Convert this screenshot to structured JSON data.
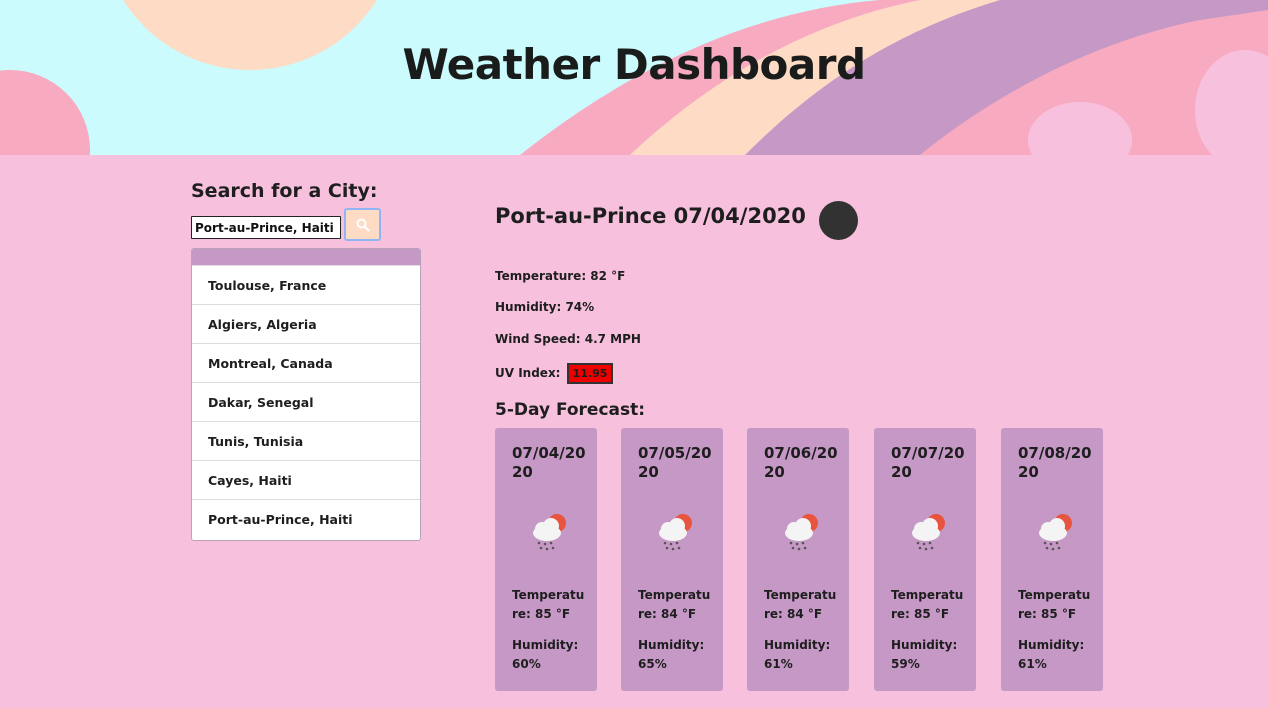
{
  "header": {
    "title": "Weather Dashboard"
  },
  "search": {
    "label": "Search for a City:",
    "value": "Port-au-Prince, Haiti",
    "button_icon": "search-icon"
  },
  "history": {
    "items": [
      {
        "label": "Toulouse, France"
      },
      {
        "label": "Algiers, Algeria"
      },
      {
        "label": "Montreal, Canada"
      },
      {
        "label": "Dakar, Senegal"
      },
      {
        "label": "Tunis, Tunisia"
      },
      {
        "label": "Cayes, Haiti"
      },
      {
        "label": "Port-au-Prince, Haiti"
      }
    ]
  },
  "current": {
    "title": "Port-au-Prince 07/04/2020",
    "icon": "weather-icon",
    "temperature": "Temperature: 82 °F",
    "humidity": "Humidity: 74%",
    "wind": "Wind Speed: 4.7 MPH",
    "uv_label": "UV Index:",
    "uv_value": "11.95",
    "uv_color": "#ee0000"
  },
  "forecast": {
    "title": "5-Day Forecast:",
    "days": [
      {
        "date": "07/04/2020",
        "icon": "rain-cloud-sun-icon",
        "temp": "Temperature: 85 °F",
        "humidity": "Humidity: 60%"
      },
      {
        "date": "07/05/2020",
        "icon": "rain-cloud-sun-icon",
        "temp": "Temperature: 84 °F",
        "humidity": "Humidity: 65%"
      },
      {
        "date": "07/06/2020",
        "icon": "rain-cloud-sun-icon",
        "temp": "Temperature: 84 °F",
        "humidity": "Humidity: 61%"
      },
      {
        "date": "07/07/2020",
        "icon": "rain-cloud-sun-icon",
        "temp": "Temperature: 85 °F",
        "humidity": "Humidity: 59%"
      },
      {
        "date": "07/08/2020",
        "icon": "rain-cloud-sun-icon",
        "temp": "Temperature: 85 °F",
        "humidity": "Humidity: 61%"
      }
    ]
  },
  "colors": {
    "background": "#f7c1de",
    "card": "#c598c5",
    "search_button": "#fddbc5",
    "hero_sky": "#cbfbfc"
  }
}
